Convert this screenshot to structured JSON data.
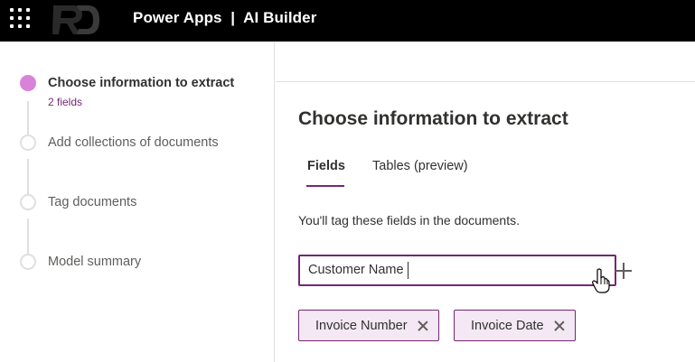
{
  "app": {
    "title": "Power Apps  |  AI Builder"
  },
  "steps": [
    {
      "label": "Choose information to extract",
      "sublabel": "2 fields",
      "active": true
    },
    {
      "label": "Add collections of documents",
      "active": false
    },
    {
      "label": "Tag documents",
      "active": false
    },
    {
      "label": "Model summary",
      "active": false
    }
  ],
  "main": {
    "title": "Choose information to extract",
    "tabs": [
      {
        "label": "Fields",
        "active": true
      },
      {
        "label": "Tables (preview)",
        "active": false
      }
    ],
    "hint": "You'll tag these fields in the documents.",
    "field_input": {
      "value": "Customer Name"
    },
    "chips": [
      {
        "label": "Invoice Number"
      },
      {
        "label": "Invoice Date"
      }
    ]
  },
  "colors": {
    "accent": "#742774",
    "active_step": "#d982d9",
    "topbar": "#000000"
  },
  "icons": {
    "waffle": "app-launcher-icon",
    "add": "plus-icon",
    "remove": "dismiss-icon",
    "cursor": "hand-pointer-icon"
  }
}
